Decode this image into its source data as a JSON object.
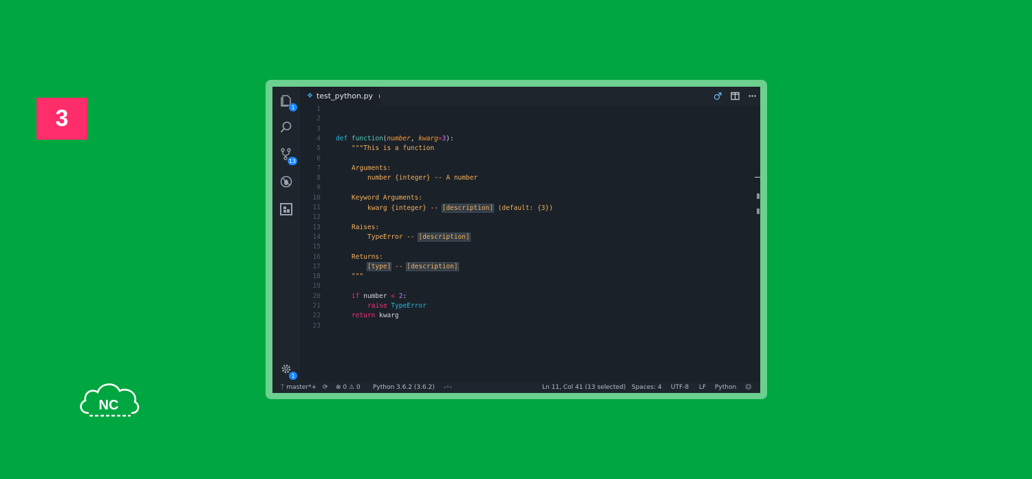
{
  "step": {
    "number": "3"
  },
  "logo": {
    "text": "NC"
  },
  "colors": {
    "background": "#00a63f",
    "badge": "#ff2d6a",
    "frame": "#6cd08f",
    "editor_bg": "#1b2128"
  },
  "activity_bar": {
    "explorer_badge": "1",
    "source_control_badge": "13",
    "settings_badge": "1",
    "icons": [
      "files-icon",
      "search-icon",
      "source-control-icon",
      "debug-icon",
      "extensions-icon",
      "gear-icon"
    ]
  },
  "tab": {
    "filename": "test_python.py",
    "icon": "python-file-icon",
    "dirty": true
  },
  "editor": {
    "line_numbers": [
      "1",
      "2",
      "3",
      "4",
      "5",
      "6",
      "7",
      "8",
      "9",
      "10",
      "11",
      "12",
      "13",
      "14",
      "15",
      "16",
      "17",
      "18",
      "19",
      "20",
      "21",
      "22",
      "23"
    ],
    "code": {
      "l4_def": "def",
      "l4_name": "function",
      "l4_open": "(",
      "l4_p1": "number",
      "l4_comma": ", ",
      "l4_p2": "kwarg",
      "l4_eq": "=",
      "l4_default": "3",
      "l4_close": "):",
      "l5": "\"\"\"This is a function",
      "l7": "Arguments:",
      "l8": "number {integer} -- A number",
      "l10": "Keyword Arguments:",
      "l11_a": "kwarg {integer} -- ",
      "l11_ph": "[description]",
      "l11_b": " (default: {3})",
      "l13": "Raises:",
      "l14_a": "TypeError -- ",
      "l14_ph": "[description]",
      "l16": "Returns:",
      "l17_ph1": "[type]",
      "l17_mid": " -- ",
      "l17_ph2": "[description]",
      "l18": "\"\"\"",
      "l20_if": "if",
      "l20_var": " number ",
      "l20_op": "<",
      "l20_sp": " ",
      "l20_num": "2",
      "l20_colon": ":",
      "l21_raise": "raise",
      "l21_sp": " ",
      "l21_cls": "TypeError",
      "l22_return": "return",
      "l22_var": " kwarg"
    }
  },
  "statusbar": {
    "branch": "master*+",
    "errors": "0",
    "warnings": "0",
    "interpreter": "Python 3.6.2 (3.6.2)",
    "cursor_position": "Ln 11, Col 41 (13 selected)",
    "indentation": "Spaces: 4",
    "encoding": "UTF-8",
    "eol": "LF",
    "language": "Python"
  }
}
